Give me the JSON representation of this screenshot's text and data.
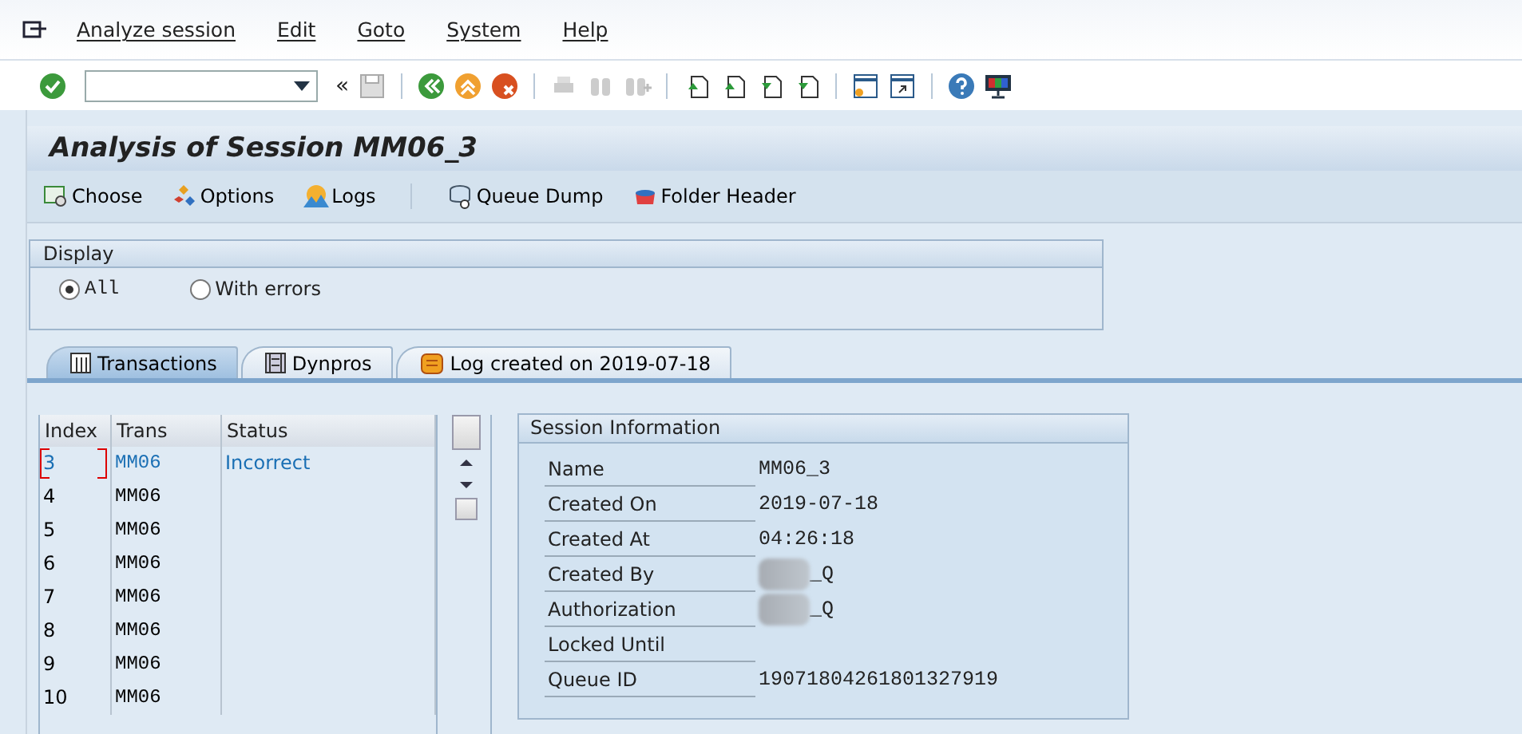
{
  "menu_bar": {
    "items": [
      "Analyze session",
      "Edit",
      "Goto",
      "System",
      "Help"
    ]
  },
  "toolbar": {
    "collapse": "«"
  },
  "title": "Analysis of Session MM06_3",
  "app_toolbar": {
    "buttons": [
      {
        "label": "Choose",
        "kind": "choose"
      },
      {
        "label": "Options",
        "kind": "options"
      },
      {
        "label": "Logs",
        "kind": "logs"
      },
      {
        "label": "Queue Dump",
        "kind": "dump"
      },
      {
        "label": "Folder Header",
        "kind": "header"
      }
    ]
  },
  "display": {
    "title": "Display",
    "options": [
      {
        "label": "All",
        "selected": true
      },
      {
        "label": "With errors",
        "selected": false
      }
    ]
  },
  "tabs": [
    {
      "label": "Transactions",
      "kind": "table",
      "selected": true
    },
    {
      "label": "Dynpros",
      "kind": "film",
      "selected": false
    },
    {
      "label": "Log created on 2019-07-18",
      "kind": "scroll",
      "selected": false
    }
  ],
  "table": {
    "columns": [
      "Index",
      "Trans",
      "Status"
    ],
    "rows": [
      {
        "index": "3",
        "trans": "MM06",
        "status": "Incorrect",
        "error": true,
        "focused": true
      },
      {
        "index": "4",
        "trans": "MM06",
        "error": false,
        "focused": false
      },
      {
        "index": "5",
        "trans": "MM06",
        "error": false,
        "focused": false
      },
      {
        "index": "6",
        "trans": "MM06",
        "error": false,
        "focused": false
      },
      {
        "index": "7",
        "trans": "MM06",
        "error": false,
        "focused": false
      },
      {
        "index": "8",
        "trans": "MM06",
        "error": false,
        "focused": false
      },
      {
        "index": "9",
        "trans": "MM06",
        "error": false,
        "focused": false
      },
      {
        "index": "10",
        "trans": "MM06",
        "error": false,
        "focused": false
      }
    ]
  },
  "session_info": {
    "title": "Session Information",
    "fields": [
      {
        "label": "Name",
        "value": "MM06_3",
        "blurred": false
      },
      {
        "label": "Created On",
        "value": "2019-07-18",
        "blurred": false
      },
      {
        "label": "Created At",
        "value": "04:26:18",
        "blurred": false
      },
      {
        "label": "Created By",
        "value": "_Q",
        "blurred": true
      },
      {
        "label": "Authorization",
        "value": "_Q",
        "blurred": true
      },
      {
        "label": "Locked Until",
        "blurred": false
      },
      {
        "label": "Queue ID",
        "value": "19071804261801327919",
        "blurred": false
      }
    ]
  }
}
